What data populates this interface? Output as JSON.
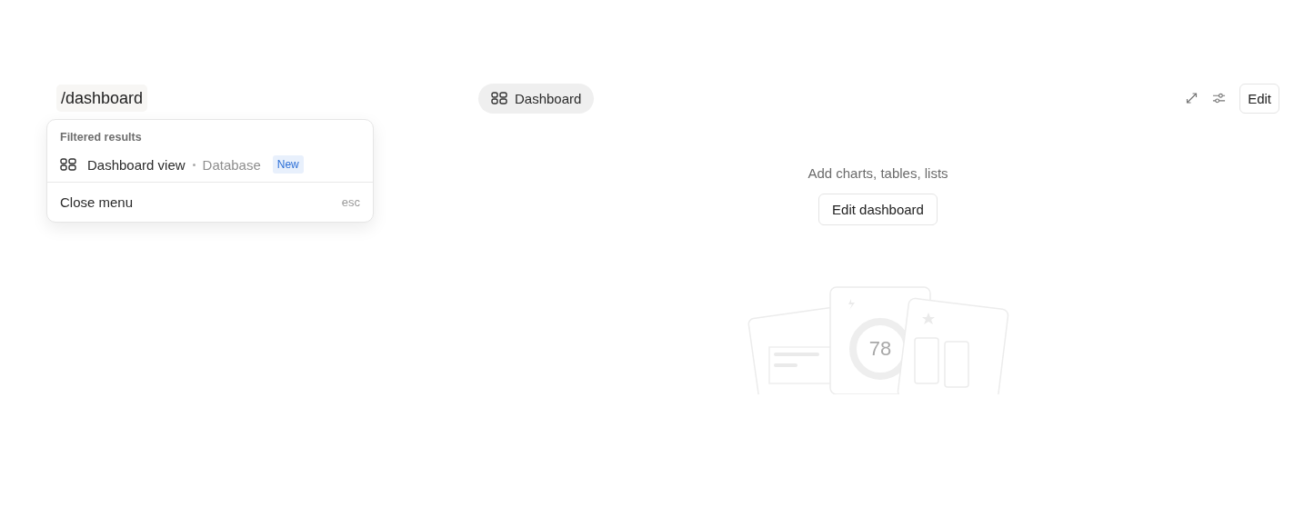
{
  "page_title": "/dashboard",
  "view_tab": {
    "label": "Dashboard",
    "selected": true
  },
  "toolbar": {
    "edit_button": "Edit"
  },
  "menu": {
    "section_label": "Filtered results",
    "items": [
      {
        "label": "Dashboard view",
        "source": "Database",
        "badge": "New"
      }
    ],
    "close": {
      "label": "Close menu",
      "shortcut": "esc"
    }
  },
  "empty_state": {
    "message": "Add charts, tables, lists",
    "button": "Edit dashboard",
    "illustration_value": "78"
  }
}
